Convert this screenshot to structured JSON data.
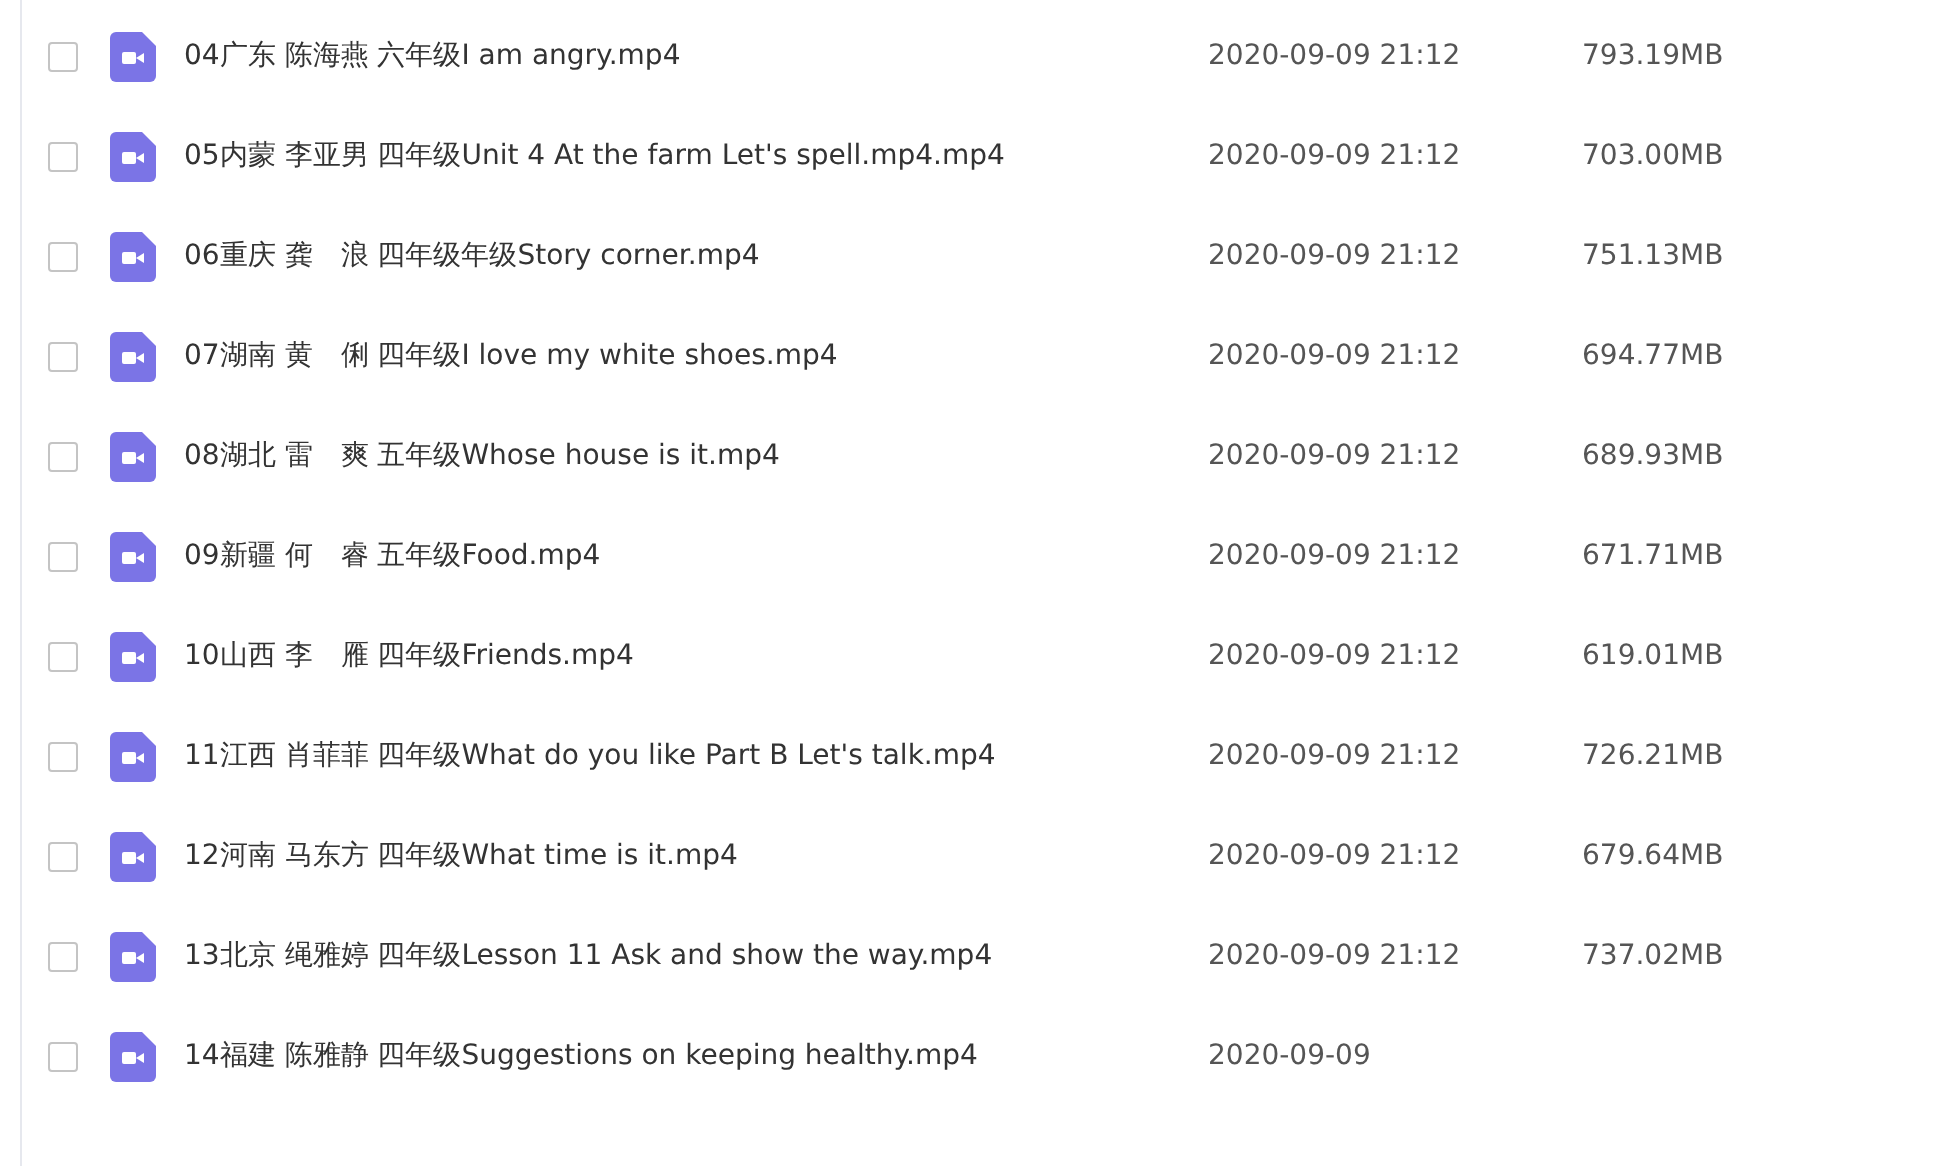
{
  "files": [
    {
      "name": "04广东 陈海燕 六年级I am angry.mp4",
      "checked": false,
      "date": "2020-09-09 21:12",
      "size": "793.19MB"
    },
    {
      "name": "05内蒙 李亚男 四年级Unit 4 At the farm Let's spell.mp4.mp4",
      "checked": false,
      "date": "2020-09-09 21:12",
      "size": "703.00MB"
    },
    {
      "name": "06重庆 龚　浪 四年级年级Story corner.mp4",
      "checked": false,
      "date": "2020-09-09 21:12",
      "size": "751.13MB"
    },
    {
      "name": "07湖南 黄　俐 四年级I love my white shoes.mp4",
      "checked": false,
      "date": "2020-09-09 21:12",
      "size": "694.77MB"
    },
    {
      "name": "08湖北 雷　爽 五年级Whose house is it.mp4",
      "checked": false,
      "date": "2020-09-09 21:12",
      "size": "689.93MB"
    },
    {
      "name": "09新疆 何　睿 五年级Food.mp4",
      "checked": false,
      "date": "2020-09-09 21:12",
      "size": "671.71MB"
    },
    {
      "name": "10山西 李　雁 四年级Friends.mp4",
      "checked": false,
      "date": "2020-09-09 21:12",
      "size": "619.01MB"
    },
    {
      "name": "11江西 肖菲菲 四年级What do you like Part B Let's talk.mp4",
      "checked": false,
      "date": "2020-09-09 21:12",
      "size": "726.21MB"
    },
    {
      "name": "12河南 马东方 四年级What time is it.mp4",
      "checked": false,
      "date": "2020-09-09 21:12",
      "size": "679.64MB"
    },
    {
      "name": "13北京 绳雅婷 四年级Lesson 11 Ask and show the way.mp4",
      "checked": false,
      "date": "2020-09-09 21:12",
      "size": "737.02MB"
    },
    {
      "name": "14福建 陈雅静 四年级Suggestions on keeping healthy.mp4",
      "checked": false,
      "date": "2020-09-09"
    }
  ]
}
